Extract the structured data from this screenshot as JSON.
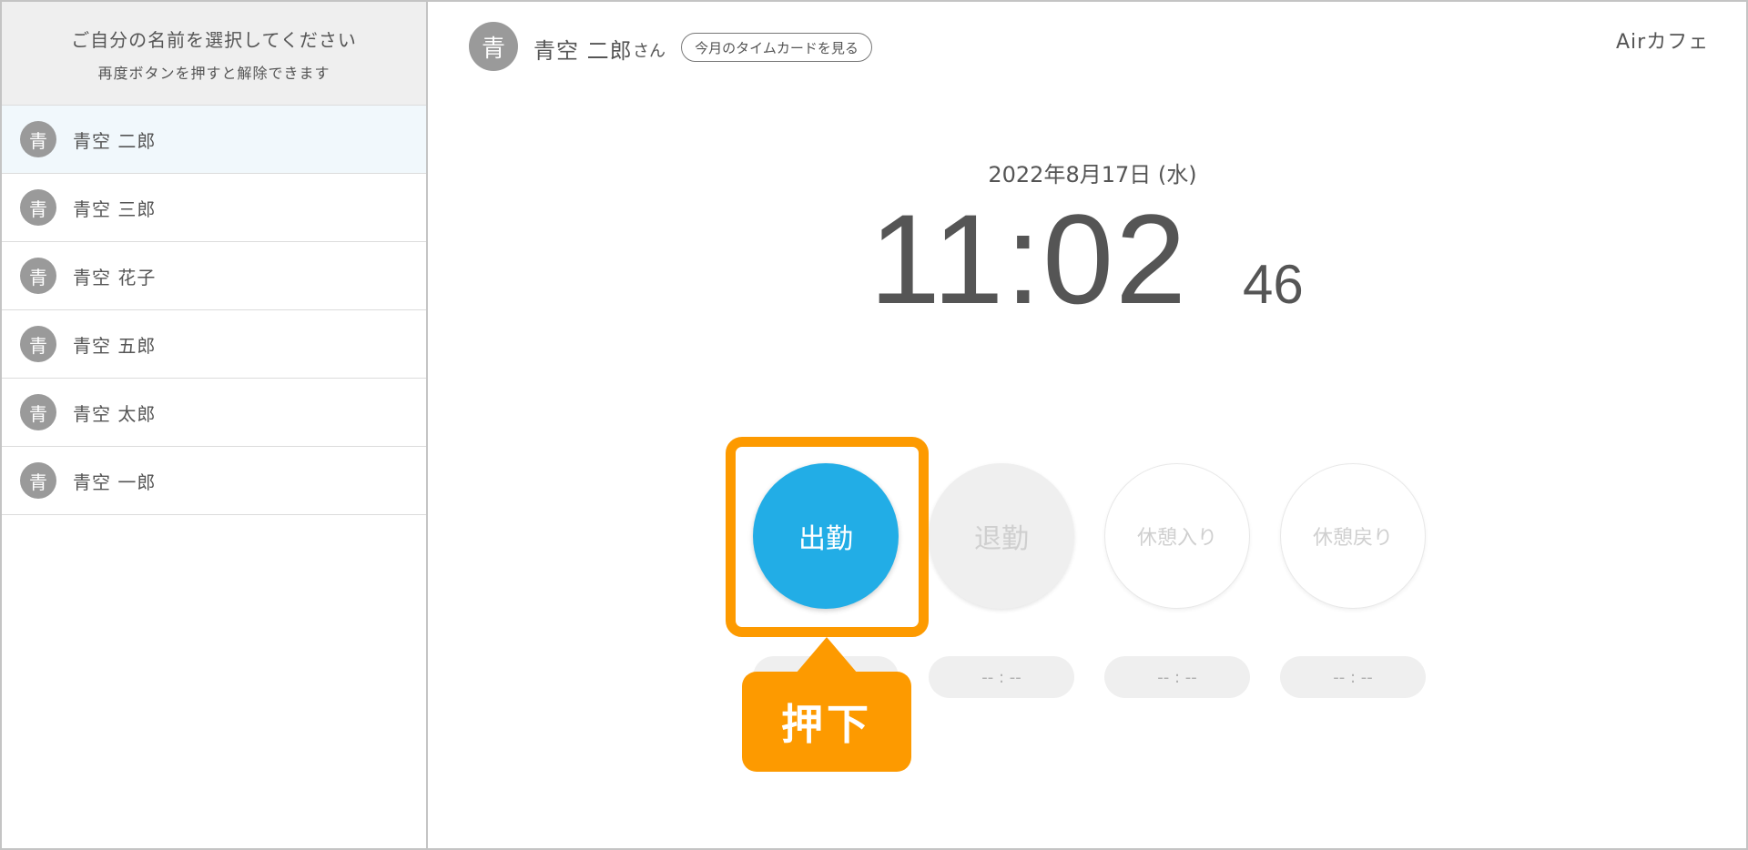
{
  "sidebar": {
    "title": "ご自分の名前を選択してください",
    "subtitle": "再度ボタンを押すと解除できます",
    "employees": [
      {
        "avatar": "青",
        "name": "青空 二郎",
        "selected": true
      },
      {
        "avatar": "青",
        "name": "青空 三郎"
      },
      {
        "avatar": "青",
        "name": "青空 花子"
      },
      {
        "avatar": "青",
        "name": "青空 五郎"
      },
      {
        "avatar": "青",
        "name": "青空 太郎"
      },
      {
        "avatar": "青",
        "name": "青空 一郎"
      }
    ]
  },
  "header": {
    "user_avatar": "青",
    "user_name": "青空 二郎",
    "user_suffix": "さん",
    "timecard_link": "今月のタイムカードを見る",
    "store_name": "Airカフェ"
  },
  "clock": {
    "date": "2022年8月17日 (水)",
    "time": "11:02",
    "seconds": "46"
  },
  "punch": {
    "clock_in": "出勤",
    "clock_out": "退勤",
    "break_start": "休憩入り",
    "break_end": "休憩戻り",
    "empty_time": "-- : --"
  },
  "annotation": {
    "label": "押下"
  },
  "colors": {
    "accent_blue": "#22ade6",
    "annotation_orange": "#fd9a00",
    "avatar_gray": "#9a9a9a"
  }
}
